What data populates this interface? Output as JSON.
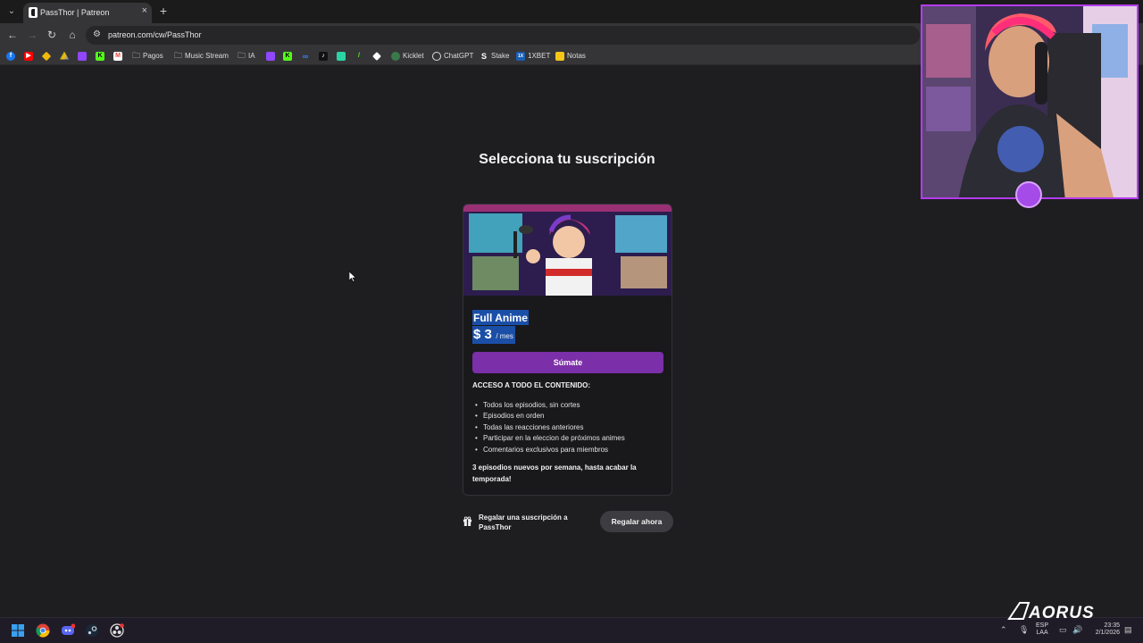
{
  "browser": {
    "tab_title": "PassThor | Patreon",
    "tab_close": "×",
    "new_tab": "+",
    "url": "patreon.com/cw/PassThor",
    "bookmarks": {
      "pagos": "Pagos",
      "music_stream": "Music Stream",
      "ia": "IA",
      "kicklet": "Kicklet",
      "chatgpt": "ChatGPT",
      "stake": "Stake",
      "xbet": "1XBET",
      "notas": "Notas"
    }
  },
  "page": {
    "title": "Selecciona tu suscripción",
    "tier": {
      "name": "Full Anime",
      "price": "$ 3",
      "period": "/ mes",
      "join_label": "Súmate",
      "access_heading": "ACCESO A TODO EL CONTENIDO:",
      "benefits": [
        "Todos los episodios, sin cortes",
        "Episodios en orden",
        "Todas las reacciones anteriores",
        "Participar en la eleccion de próximos animes",
        "Comentarios exclusivos para miembros"
      ],
      "note": "3 episodios nuevos por semana, hasta acabar la temporada!"
    },
    "gift": {
      "text": "Regalar una suscripción a PassThor",
      "button": "Regalar ahora"
    }
  },
  "taskbar": {
    "lang_top": "ESP",
    "lang_bottom": "LAA",
    "time": "23:35",
    "date": "2/1/2026"
  },
  "colors": {
    "accent": "#7b2fa8",
    "selection": "#1b4fa7",
    "background": "#1e1d20"
  }
}
